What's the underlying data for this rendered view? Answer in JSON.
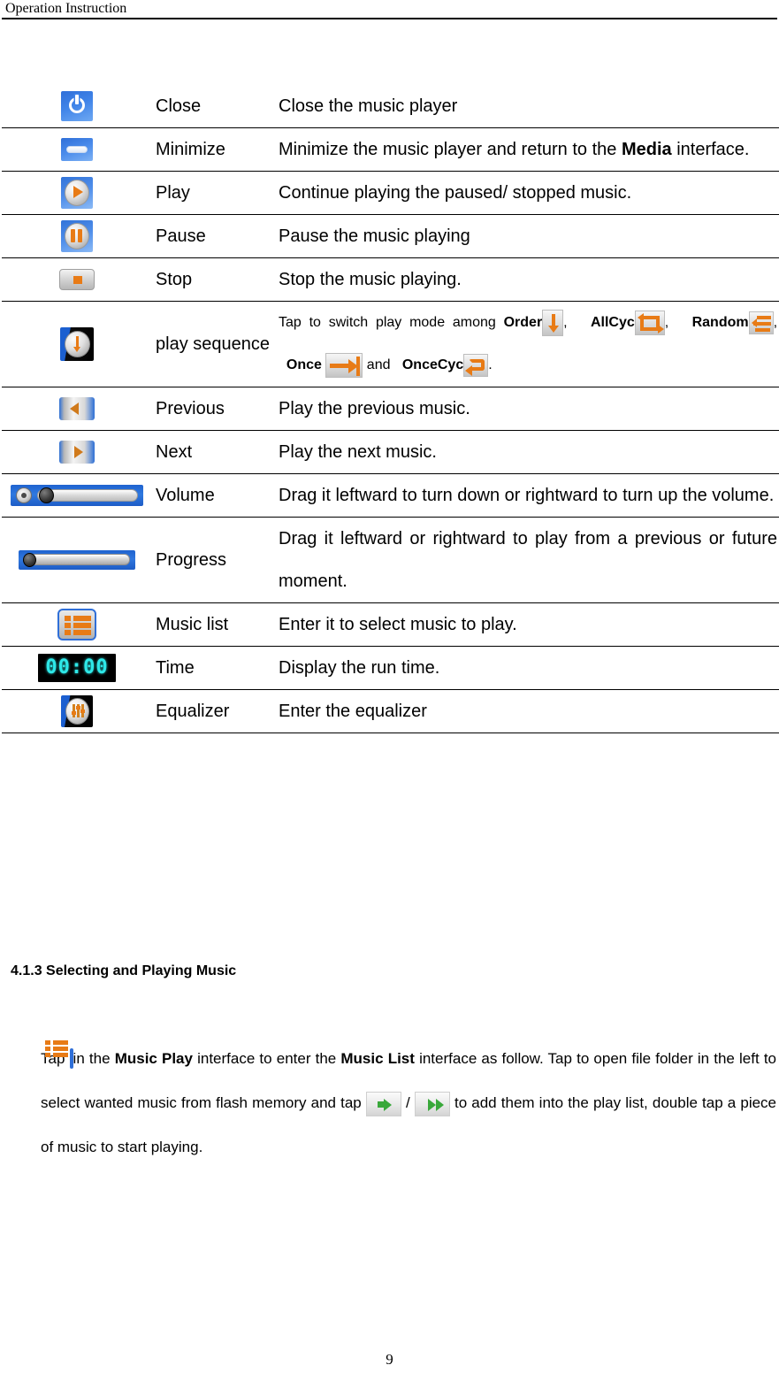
{
  "header": {
    "title": "Operation Instruction"
  },
  "table": {
    "rows": [
      {
        "icon": "power-icon",
        "name": "Close",
        "desc": "Close the music player"
      },
      {
        "icon": "minimize-icon",
        "name": "Minimize",
        "desc_parts": [
          {
            "text": "Minimize the music player and return to the ",
            "bold": false
          },
          {
            "text": "Media",
            "bold": true
          },
          {
            "text": " interface.",
            "bold": false
          }
        ]
      },
      {
        "icon": "play-icon",
        "name": "Play",
        "desc": "Continue playing the paused/ stopped music."
      },
      {
        "icon": "pause-icon",
        "name": "Pause",
        "desc": "Pause the music playing"
      },
      {
        "icon": "stop-icon",
        "name": "Stop",
        "desc": "Stop the music playing."
      },
      {
        "icon": "play-sequence-icon",
        "name": "play sequence",
        "desc_prefix": "Tap to switch play mode among ",
        "modes": [
          {
            "label": "Order",
            "icon": "order-mode-icon",
            "sep": ", "
          },
          {
            "label": "AllCyc",
            "icon": "allcyc-mode-icon",
            "sep": ", "
          },
          {
            "label": "Random",
            "icon": "random-mode-icon",
            "sep": ", "
          },
          {
            "label": "Once",
            "icon": "once-mode-icon",
            "sep": " and "
          },
          {
            "label": "OnceCyc",
            "icon": "oncecyc-mode-icon",
            "sep": "."
          }
        ]
      },
      {
        "icon": "previous-icon",
        "name": "Previous",
        "desc": "Play the previous music."
      },
      {
        "icon": "next-icon",
        "name": "Next",
        "desc": "Play the next music."
      },
      {
        "icon": "volume-slider-icon",
        "name": "Volume",
        "desc": "Drag it leftward to turn down or rightward to turn up the volume."
      },
      {
        "icon": "progress-slider-icon",
        "name": "Progress",
        "desc": "Drag it leftward or rightward to play from a previous or future moment."
      },
      {
        "icon": "music-list-icon",
        "name": "Music list",
        "desc": "Enter it to select music to play."
      },
      {
        "icon": "time-display-icon",
        "name": "Time",
        "desc": "Display the run time.",
        "time_value": "00:00"
      },
      {
        "icon": "equalizer-icon",
        "name": "Equalizer",
        "desc": "Enter the equalizer"
      }
    ]
  },
  "section": {
    "heading": "4.1.3 Selecting and Playing Music",
    "paragraph": {
      "p1": "Tap ",
      "p2": " in the ",
      "b1": "Music Play",
      "p3": " interface to enter the ",
      "b2": "Music List",
      "p4": " interface as follow. Tap to open file folder in the left to select wanted music from flash memory and tap ",
      "p5": " / ",
      "p6": " to add them into the play list, double tap a piece of music to start playing."
    }
  },
  "footer": {
    "page_number": "9"
  },
  "colors": {
    "accent_orange": "#e87b16",
    "accent_blue": "#2f6fd8",
    "lcd_cyan": "#2ee8e8",
    "green_arrow": "#39a83a",
    "rule": "#000000"
  }
}
